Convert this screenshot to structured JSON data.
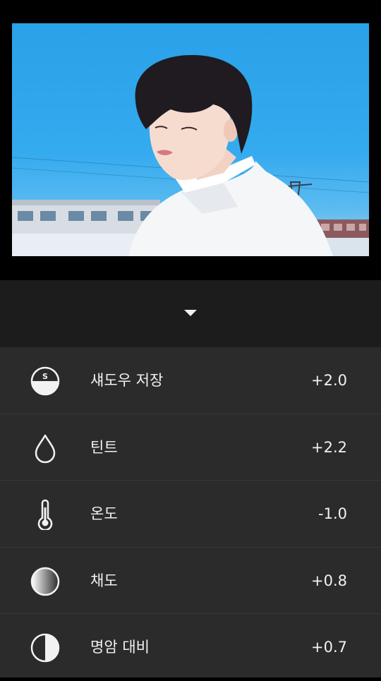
{
  "editor": {
    "collapse_icon": "triangle-down-icon"
  },
  "adjustments": [
    {
      "label": "섀도우 저장",
      "value": "+2.0",
      "icon": "shadow-save-icon",
      "icon_letter": "S"
    },
    {
      "label": "틴트",
      "value": "+2.2",
      "icon": "droplet-icon"
    },
    {
      "label": "온도",
      "value": "-1.0",
      "icon": "thermometer-icon"
    },
    {
      "label": "채도",
      "value": "+0.8",
      "icon": "saturation-icon"
    },
    {
      "label": "명암 대비",
      "value": "+0.7",
      "icon": "contrast-icon"
    }
  ],
  "colors": {
    "background": "#000000",
    "toolbar": "#1c1c1c",
    "list_background": "#2b2b2b",
    "divider": "#383838",
    "text": "#f2f2f2"
  }
}
